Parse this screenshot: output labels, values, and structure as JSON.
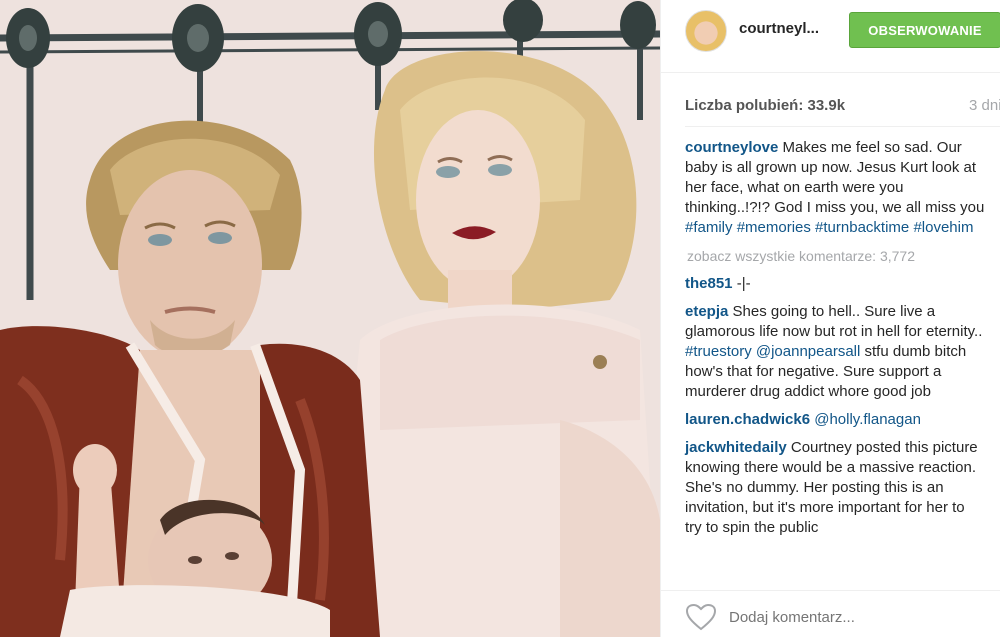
{
  "post": {
    "image_alt": "Photo of a couple with a baby in front of an iron bed frame"
  },
  "header": {
    "username": "courtneyl...",
    "follow_label": "OBSERWOWANIE"
  },
  "stats": {
    "likes": "Liczba polubień: 33.9k",
    "time": "3 dni"
  },
  "caption": {
    "user": "courtneylove",
    "text": "Makes me feel so sad. Our baby is all grown up now. Jesus Kurt look at her face, what on earth were you thinking..!?!? God I miss you, we all miss you",
    "hashtags": [
      "#family",
      "#memories",
      "#turnbacktime",
      "#lovehim"
    ]
  },
  "view_all_comments": "zobacz wszystkie komentarze: 3,772",
  "comments": [
    {
      "user": "the851",
      "parts": [
        {
          "t": " -|-",
          "tag": false
        }
      ]
    },
    {
      "user": "etepja",
      "parts": [
        {
          "t": " Shes going to hell.. Sure live a glamorous life now but rot in hell for eternity.. ",
          "tag": false
        },
        {
          "t": "#truestory",
          "tag": true
        },
        {
          "t": " ",
          "tag": false
        },
        {
          "t": "@joannpearsall",
          "tag": true
        },
        {
          "t": " stfu dumb bitch how's that for negative. Sure support a murderer drug addict whore good job",
          "tag": false
        }
      ]
    },
    {
      "user": "lauren.chadwick6",
      "parts": [
        {
          "t": " ",
          "tag": false
        },
        {
          "t": "@holly.flanagan",
          "tag": true
        }
      ]
    },
    {
      "user": "jackwhitedaily",
      "parts": [
        {
          "t": " Courtney posted this picture knowing there would be a massive reaction. She's no dummy. Her posting this is an invitation, but it's more important for her to try to spin the public",
          "tag": false
        }
      ]
    }
  ],
  "footer": {
    "comment_placeholder": "Dodaj komentarz..."
  },
  "colors": {
    "follow_green": "#70c050",
    "link_blue": "#125688",
    "muted_gray": "#a5a7aa"
  }
}
